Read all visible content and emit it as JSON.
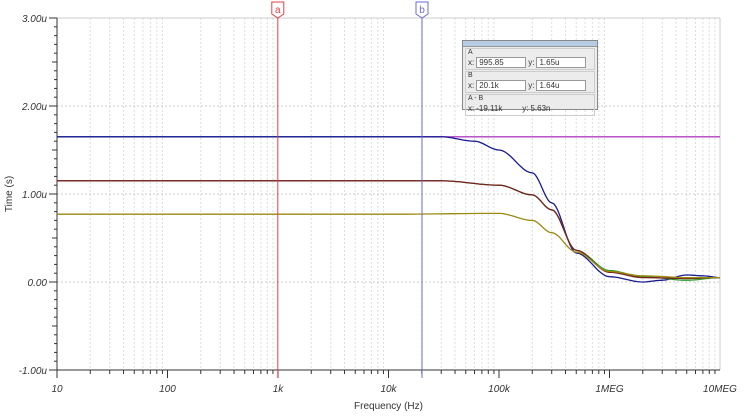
{
  "readout": {
    "a": {
      "label": "A",
      "x_label": "x:",
      "x": "995.85",
      "y_label": "y:",
      "y": "1.65u"
    },
    "b": {
      "label": "B",
      "x_label": "x:",
      "x": "20.1k",
      "y_label": "y:",
      "y": "1.64u"
    },
    "diff": {
      "label": "A - B",
      "x_label": "x:",
      "x": "-19.11k",
      "y_label": "y:",
      "y": "5.63n"
    }
  },
  "cursors": [
    {
      "label": "a",
      "freq": 995.85,
      "color": "#e0404a"
    },
    {
      "label": "b",
      "freq": 20100,
      "color": "#6a6ae0"
    }
  ],
  "chart_data": {
    "type": "line",
    "xlabel": "Frequency (Hz)",
    "ylabel": "Time (s)",
    "xscale": "log",
    "xlim": [
      10,
      10000000
    ],
    "ylim": [
      -1,
      3
    ],
    "xticks": [
      {
        "v": 10,
        "label": "10"
      },
      {
        "v": 100,
        "label": "100"
      },
      {
        "v": 1000,
        "label": "1k"
      },
      {
        "v": 10000,
        "label": "10k"
      },
      {
        "v": 100000,
        "label": "100k"
      },
      {
        "v": 1000000,
        "label": "1MEG"
      },
      {
        "v": 10000000,
        "label": "10MEG"
      }
    ],
    "yticks": [
      {
        "v": 3,
        "label": "3.00u"
      },
      {
        "v": 2,
        "label": "2.00u"
      },
      {
        "v": 1,
        "label": "1.00u"
      },
      {
        "v": 0,
        "label": "0.00"
      },
      {
        "v": -1,
        "label": "-1.00u"
      }
    ],
    "grid": true,
    "series": [
      {
        "name": "flat-magenta",
        "color": "#b040c0",
        "x": [
          20100,
          10000000
        ],
        "y": [
          1.65,
          1.65
        ]
      },
      {
        "name": "flat-blue",
        "color": "#2a78c0",
        "x": [
          10,
          20100
        ],
        "y": [
          1.65,
          1.65
        ]
      },
      {
        "name": "blue",
        "color": "#1a1a90",
        "x": [
          10,
          30000,
          60000,
          100000,
          200000,
          300000,
          500000,
          1000000,
          2000000,
          3000000,
          5000000,
          7000000,
          10000000
        ],
        "y": [
          1.65,
          1.65,
          1.6,
          1.5,
          1.24,
          0.9,
          0.33,
          0.06,
          0.0,
          0.02,
          0.08,
          0.07,
          0.05
        ]
      },
      {
        "name": "green",
        "color": "#2a9a2a",
        "x": [
          10,
          30000,
          100000,
          200000,
          300000,
          500000,
          1000000,
          2000000,
          5000000,
          10000000
        ],
        "y": [
          1.15,
          1.15,
          1.1,
          0.99,
          0.82,
          0.36,
          0.13,
          0.06,
          0.02,
          0.05
        ]
      },
      {
        "name": "darkred",
        "color": "#7a2020",
        "x": [
          10,
          30000,
          100000,
          200000,
          300000,
          500000,
          1000000,
          2000000,
          5000000,
          10000000
        ],
        "y": [
          1.15,
          1.15,
          1.1,
          0.99,
          0.82,
          0.36,
          0.11,
          0.05,
          0.04,
          0.05
        ]
      },
      {
        "name": "olive",
        "color": "#9a8a10",
        "x": [
          10,
          10000,
          100000,
          200000,
          300000,
          500000,
          1000000,
          2000000,
          5000000,
          10000000
        ],
        "y": [
          0.77,
          0.77,
          0.78,
          0.7,
          0.56,
          0.34,
          0.12,
          0.07,
          0.05,
          0.05
        ]
      }
    ]
  }
}
